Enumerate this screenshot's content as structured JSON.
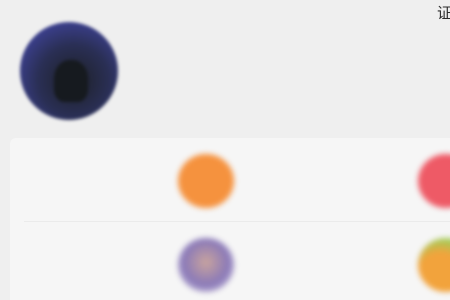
{
  "corner_glyph": "证",
  "profile": {
    "name": "",
    "subtitle": "",
    "stats": [
      {
        "label": ""
      },
      {
        "label": ""
      }
    ]
  },
  "grid": {
    "tiles": [
      {
        "title": "",
        "subtitle": "",
        "icon": "orange-icon",
        "color": "#f5923e"
      },
      {
        "title": "",
        "subtitle": "",
        "icon": "red-icon",
        "color": "#ee5a66"
      },
      {
        "title": "",
        "subtitle": "",
        "icon": "avatar-icon",
        "color": "#8a79b8"
      },
      {
        "title": "",
        "subtitle": "",
        "icon": "orange-green-icon",
        "color": "#f2a33c"
      }
    ]
  }
}
